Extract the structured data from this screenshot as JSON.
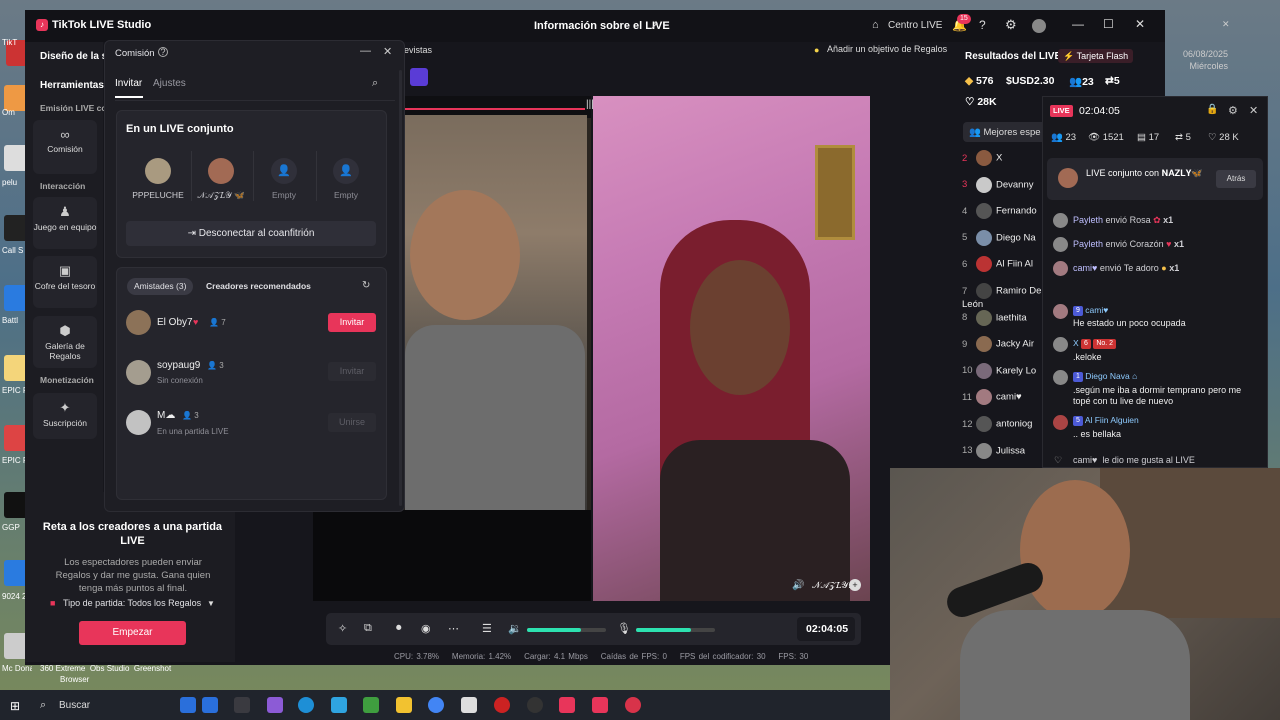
{
  "app": {
    "title": "TikTok LIVE Studio",
    "center_title": "Información sobre el LIVE",
    "centro_live": "Centro LIVE",
    "notif_count": "15"
  },
  "left": {
    "diseno": "Diseño de la s",
    "herramientas": "Herramientas",
    "emision": "Emisión LIVE co",
    "tiles": [
      {
        "label": "Comisión"
      },
      {
        "label": "Juego en equipo"
      },
      {
        "label": "Cofre del tesoro"
      },
      {
        "label": "Galería de Regalos"
      },
      {
        "label": "Suscripción"
      }
    ],
    "interaccion": "Interacción",
    "monetizacion": "Monetización"
  },
  "panel": {
    "title": "Comisión",
    "tabs": [
      "Invitar",
      "Ajustes"
    ],
    "joint_title": "En un LIVE conjunto",
    "slots": [
      {
        "name": "PPPELUCHE"
      },
      {
        "name": "𝒩𝒜𝒵𝐿𝒴 🦋"
      },
      {
        "name": "Empty"
      },
      {
        "name": "Empty"
      }
    ],
    "disconnect": "Desconectar al coanfitrión",
    "pill_friends": "Amistades (3)",
    "pill_recommended": "Creadores recomendados",
    "friends": [
      {
        "name": "El Oby7",
        "count": "7",
        "sub": "",
        "action": "Invitar"
      },
      {
        "name": "soypaug9",
        "count": "3",
        "sub": "Sin conexión",
        "action": "Invitar"
      },
      {
        "name": "M☁",
        "count": "3",
        "sub": "En una partida LIVE",
        "action": "Unirse"
      }
    ]
  },
  "challenge": {
    "title": "Reta a los creadores a una partida LIVE",
    "body": "Los espectadores pueden enviar Regalos y dar me gusta. Gana quien tenga más puntos al final.",
    "type": "Tipo de partida: Todos los Regalos",
    "start": "Empezar"
  },
  "stage": {
    "tab": "evistas",
    "add_goal": "Añadir un objetivo de Regalos",
    "cohost_name": "𝒩𝒜𝒵𝐿𝒴..."
  },
  "controls": {
    "timer": "02:04:05",
    "mic_level": 0.7,
    "volume_level": 0.68
  },
  "stats": {
    "cpu": "CPU: 3.78%",
    "mem": "Memoria: 1.42%",
    "up": "Cargar: 4.1 Mbps",
    "drops": "Caídas de FPS: 0",
    "enc": "FPS del codificador: 30",
    "fps": "FPS: 30"
  },
  "results": {
    "title": "Resultados del LIVE",
    "flash": "Tarjeta Flash",
    "date": "06/08/2025",
    "weekday": "Miércoles",
    "diamonds": "576",
    "usd": "USD2.30",
    "people": "23",
    "share": "5",
    "likes": "28K",
    "best": "Mejores espe",
    "ranks": [
      {
        "n": "2",
        "name": "X"
      },
      {
        "n": "3",
        "name": "Devanny"
      },
      {
        "n": "4",
        "name": "Fernando"
      },
      {
        "n": "5",
        "name": "Diego Na"
      },
      {
        "n": "6",
        "name": "Al Fiin Al"
      },
      {
        "n": "7",
        "name": "Ramiro De León"
      },
      {
        "n": "8",
        "name": "laethita"
      },
      {
        "n": "9",
        "name": "Jacky Air"
      },
      {
        "n": "10",
        "name": "Karely Lo"
      },
      {
        "n": "11",
        "name": "cami♥"
      },
      {
        "n": "12",
        "name": "antoniog"
      },
      {
        "n": "13",
        "name": "Julissa"
      }
    ]
  },
  "overlay": {
    "live": "LIVE",
    "time": "02:04:05",
    "viewers": "23",
    "views": "1521",
    "gifts": "17",
    "share": "5",
    "likes": "28 K",
    "coop_text": "LIVE conjunto con 𝐍𝐀𝐙𝐋𝐘🦋",
    "coop_back": "Atrás",
    "gifts_feed": [
      {
        "user": "Payleth",
        "text": "envió Rosa",
        "x": "x1"
      },
      {
        "user": "Payleth",
        "text": "envió Corazón",
        "x": "x1"
      },
      {
        "user": "cami♥",
        "text": "envió Te adoro",
        "x": "x1"
      }
    ],
    "chat": [
      {
        "lvl": "9",
        "user": "cami♥",
        "msg": "He estado un poco ocupada"
      },
      {
        "lvl": "6",
        "user": "X",
        "badge": "No. 2",
        "msg": ".keloke"
      },
      {
        "lvl": "1",
        "user": "Diego Nava",
        "msg": ".según me iba a dormir temprano pero me topé con tu live de nuevo"
      },
      {
        "lvl": "5",
        "user": "Al Fiin Alguien",
        "msg": ".. es bellaka"
      },
      {
        "user": "cami♥",
        "msg": "le dio me gusta al LIVE"
      }
    ]
  },
  "desktop": {
    "labels": [
      "TikT",
      "Om",
      "pelu",
      "Call S",
      "Battl",
      "EPIC Fu",
      "EPIC Fu",
      "GGP",
      "9024 2888",
      "Mc Donald"
    ]
  },
  "taskbar": {
    "search": "Buscar"
  },
  "bottom_labels": {
    "a": "McDonalds",
    "b": "360 Extreme",
    "c": "Obs Studio",
    "d": "Greenshot",
    "e": "Browser"
  },
  "colors": {
    "accent": "#e8355a",
    "meter": "#2de2b0"
  }
}
